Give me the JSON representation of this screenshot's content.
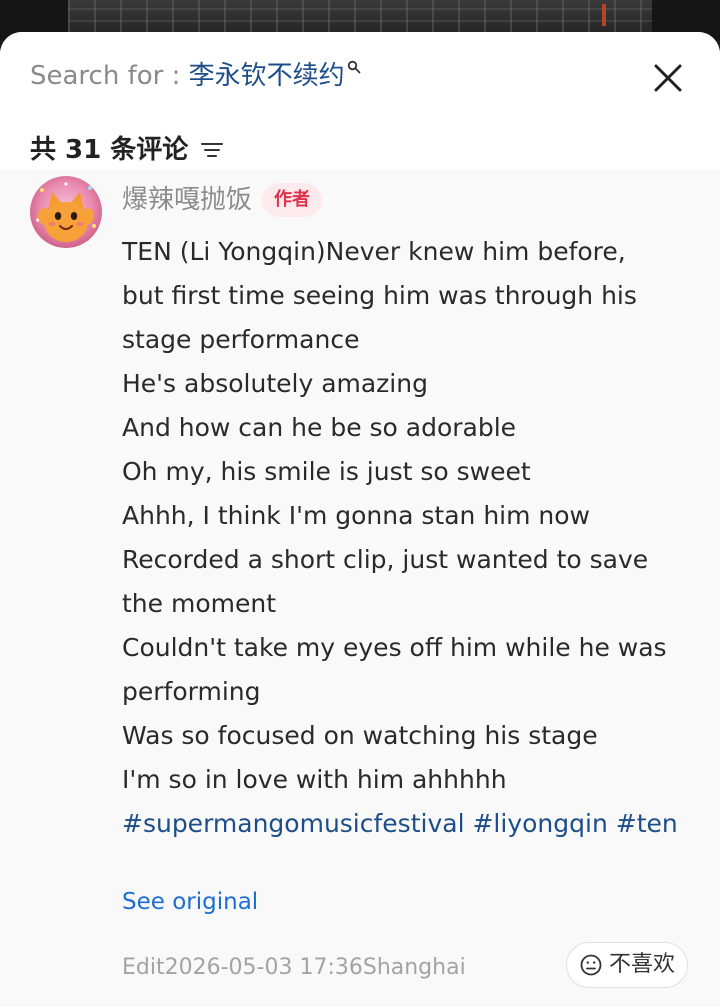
{
  "header": {
    "search_prefix": "Search for : ",
    "search_query": "李永钦不续约",
    "search_icon": "search-icon",
    "close_icon": "close-icon",
    "comment_count": "共 31 条评论",
    "sort_icon": "sort-filter-icon"
  },
  "comment": {
    "author": "爆辣嘎抛饭",
    "author_badge": "作者",
    "avatar_icon": "cartoon-cat-avatar",
    "lines": [
      "TEN (Li Yongqin)Never knew him before,",
      "but first time seeing him was through his",
      "stage performance",
      "He's absolutely amazing",
      "And how can he be so adorable",
      "Oh my, his smile is just so sweet",
      "Ahhh, I think I'm gonna stan him now",
      "Recorded a short clip, just wanted to save",
      "the moment",
      "Couldn't take my eyes off him while he was",
      "performing",
      "Was so focused on watching his stage",
      "I'm so in love with him ahhhhh"
    ],
    "hashtags": [
      "#supermangomusicfestival",
      "#liyongqin",
      "#ten"
    ],
    "see_original": "See original",
    "meta": "Edit2026-05-03 17:36Shanghai",
    "dislike_label": "不喜欢",
    "dislike_icon": "frown-face-icon"
  },
  "colors": {
    "link_blue": "#1c6ed4",
    "hashtag_blue": "#1d4e89",
    "badge_red": "#e0324b",
    "badge_bg": "#fdeaec"
  }
}
